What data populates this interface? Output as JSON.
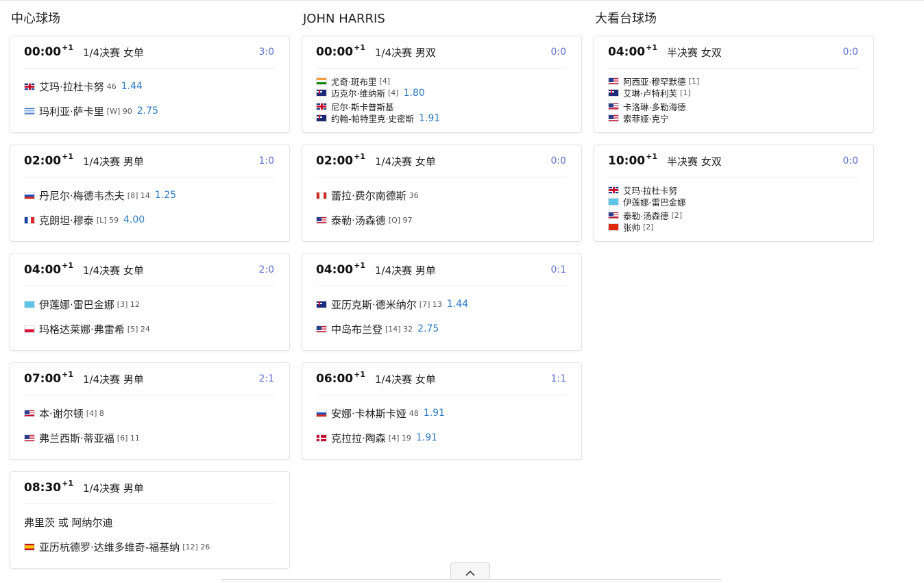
{
  "columns": [
    {
      "title": "中心球场",
      "matches": [
        {
          "time": "00:00",
          "sup": "+1",
          "round": "1/4决赛 女单",
          "score": "3:0",
          "type": "singles",
          "players": [
            {
              "flag": "gb",
              "name": "艾玛·拉杜卡努",
              "num": "46",
              "odds": "1.44"
            },
            {
              "flag": "gr",
              "name": "玛利亚·萨卡里",
              "num": "[W] 90",
              "odds": "2.75"
            }
          ]
        },
        {
          "time": "02:00",
          "sup": "+1",
          "round": "1/4决赛 男单",
          "score": "1:0",
          "type": "singles",
          "players": [
            {
              "flag": "ru",
              "name": "丹尼尔·梅德韦杰夫",
              "num": "[8] 14",
              "odds": "1.25"
            },
            {
              "flag": "fr",
              "name": "克朗坦·穆泰",
              "num": "[L] 59",
              "odds": "4.00"
            }
          ]
        },
        {
          "time": "04:00",
          "sup": "+1",
          "round": "1/4决赛 女单",
          "score": "2:0",
          "type": "singles",
          "players": [
            {
              "flag": "kz",
              "name": "伊莲娜·雷巴金娜",
              "num": "[3] 12",
              "odds": ""
            },
            {
              "flag": "pl",
              "name": "玛格达莱娜·弗雷希",
              "num": "[5] 24",
              "odds": ""
            }
          ]
        },
        {
          "time": "07:00",
          "sup": "+1",
          "round": "1/4决赛 男单",
          "score": "2:1",
          "type": "singles",
          "players": [
            {
              "flag": "us",
              "name": "本·谢尔顿",
              "num": "[4] 8",
              "odds": ""
            },
            {
              "flag": "us",
              "name": "弗兰西斯·蒂亚福",
              "num": "[6] 11",
              "odds": ""
            }
          ]
        },
        {
          "time": "08:30",
          "sup": "+1",
          "round": "1/4决赛 男单",
          "score": "",
          "type": "singles",
          "players": [
            {
              "flag": "",
              "name": "弗里茨 或 阿纳尔迪",
              "num": "",
              "odds": "",
              "plain": true
            },
            {
              "flag": "es",
              "name": "亚历杭德罗·达维多维奇-福基纳",
              "num": "[12] 26",
              "odds": ""
            }
          ]
        }
      ]
    },
    {
      "title": "JOHN HARRIS",
      "matches": [
        {
          "time": "00:00",
          "sup": "+1",
          "round": "1/4决赛 男双",
          "score": "0:0",
          "type": "doubles",
          "players": [
            {
              "flag": "in",
              "name": "尤奇·斑布里",
              "num": "[4]",
              "odds": ""
            },
            {
              "flag": "nz",
              "name": "迈克尔·维纳斯",
              "num": "[4]",
              "odds": "1.80"
            },
            {
              "flag": "gb",
              "name": "尼尔·斯卡普斯基",
              "num": "",
              "odds": ""
            },
            {
              "flag": "au",
              "name": "约翰-帕特里克·史密斯",
              "num": "",
              "odds": "1.91"
            }
          ]
        },
        {
          "time": "02:00",
          "sup": "+1",
          "round": "1/4决赛 女单",
          "score": "0:0",
          "type": "singles",
          "players": [
            {
              "flag": "ca",
              "name": "蕾拉·费尔南德斯",
              "num": "36",
              "odds": ""
            },
            {
              "flag": "us",
              "name": "泰勒·汤森德",
              "num": "[Q] 97",
              "odds": ""
            }
          ]
        },
        {
          "time": "04:00",
          "sup": "+1",
          "round": "1/4决赛 男单",
          "score": "0:1",
          "type": "singles",
          "players": [
            {
              "flag": "au",
              "name": "亚历克斯·德米纳尔",
              "num": "[7] 13",
              "odds": "1.44"
            },
            {
              "flag": "us",
              "name": "中岛布兰登",
              "num": "[14] 32",
              "odds": "2.75"
            }
          ]
        },
        {
          "time": "06:00",
          "sup": "+1",
          "round": "1/4决赛 女单",
          "score": "1:1",
          "type": "singles",
          "players": [
            {
              "flag": "ru",
              "name": "安娜·卡林斯卡娅",
              "num": "48",
              "odds": "1.91"
            },
            {
              "flag": "dk",
              "name": "克拉拉·陶森",
              "num": "[4] 19",
              "odds": "1.91"
            }
          ]
        }
      ]
    },
    {
      "title": "大看台球场",
      "matches": [
        {
          "time": "04:00",
          "sup": "+1",
          "round": "半决赛 女双",
          "score": "0:0",
          "type": "doubles",
          "players": [
            {
              "flag": "us",
              "name": "阿西亚·穆罕默德",
              "num": "[1]",
              "odds": ""
            },
            {
              "flag": "nz",
              "name": "艾琳·卢特利芙",
              "num": "[1]",
              "odds": ""
            },
            {
              "flag": "us",
              "name": "卡洛琳·多勒海德",
              "num": "",
              "odds": ""
            },
            {
              "flag": "us",
              "name": "索菲娅·克宁",
              "num": "",
              "odds": ""
            }
          ]
        },
        {
          "time": "10:00",
          "sup": "+1",
          "round": "半决赛 女双",
          "score": "0:0",
          "type": "doubles",
          "players": [
            {
              "flag": "gb",
              "name": "艾玛·拉杜卡努",
              "num": "",
              "odds": ""
            },
            {
              "flag": "kz",
              "name": "伊莲娜·雷巴金娜",
              "num": "",
              "odds": ""
            },
            {
              "flag": "us",
              "name": "泰勒·汤森德",
              "num": "[2]",
              "odds": ""
            },
            {
              "flag": "cn",
              "name": "张帅",
              "num": "[2]",
              "odds": ""
            }
          ]
        }
      ]
    }
  ],
  "scroll_top_icon": "chevron-up-icon"
}
